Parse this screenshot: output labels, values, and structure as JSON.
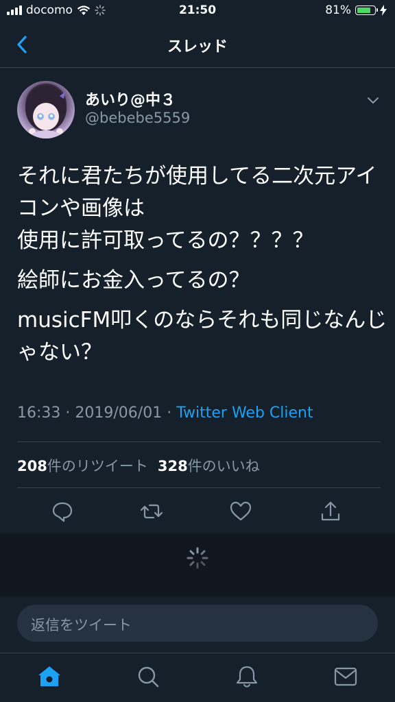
{
  "status_bar": {
    "carrier": "docomo",
    "time": "21:50",
    "battery_percent": "81%",
    "battery_level": 0.81,
    "battery_color": "#4cd964"
  },
  "header": {
    "title": "スレッド",
    "back_icon": "chevron-left-icon"
  },
  "tweet": {
    "author_name": "あいり@中３",
    "author_handle": "@bebebe5559",
    "paragraphs": [
      "それに君たちが使用してる二次元アイコンや画像は\n使用に許可取ってるの？？？？",
      "絵師にお金入ってるの？",
      "musicFM叩くのならそれも同じなんじゃない？"
    ],
    "time": "16:33",
    "date": "2019/06/01",
    "separator": "·",
    "client": "Twitter Web Client",
    "retweet_count": "208",
    "retweet_label": "件のリツイート",
    "like_count": "328",
    "like_label": "件のいいね"
  },
  "composer": {
    "placeholder": "返信をツイート"
  },
  "colors": {
    "background": "#15202b",
    "accent": "#1da1f2",
    "secondary_text": "#8899a6",
    "divider": "#38444d"
  },
  "tabs": [
    "home-icon",
    "search-icon",
    "bell-icon",
    "mail-icon"
  ]
}
